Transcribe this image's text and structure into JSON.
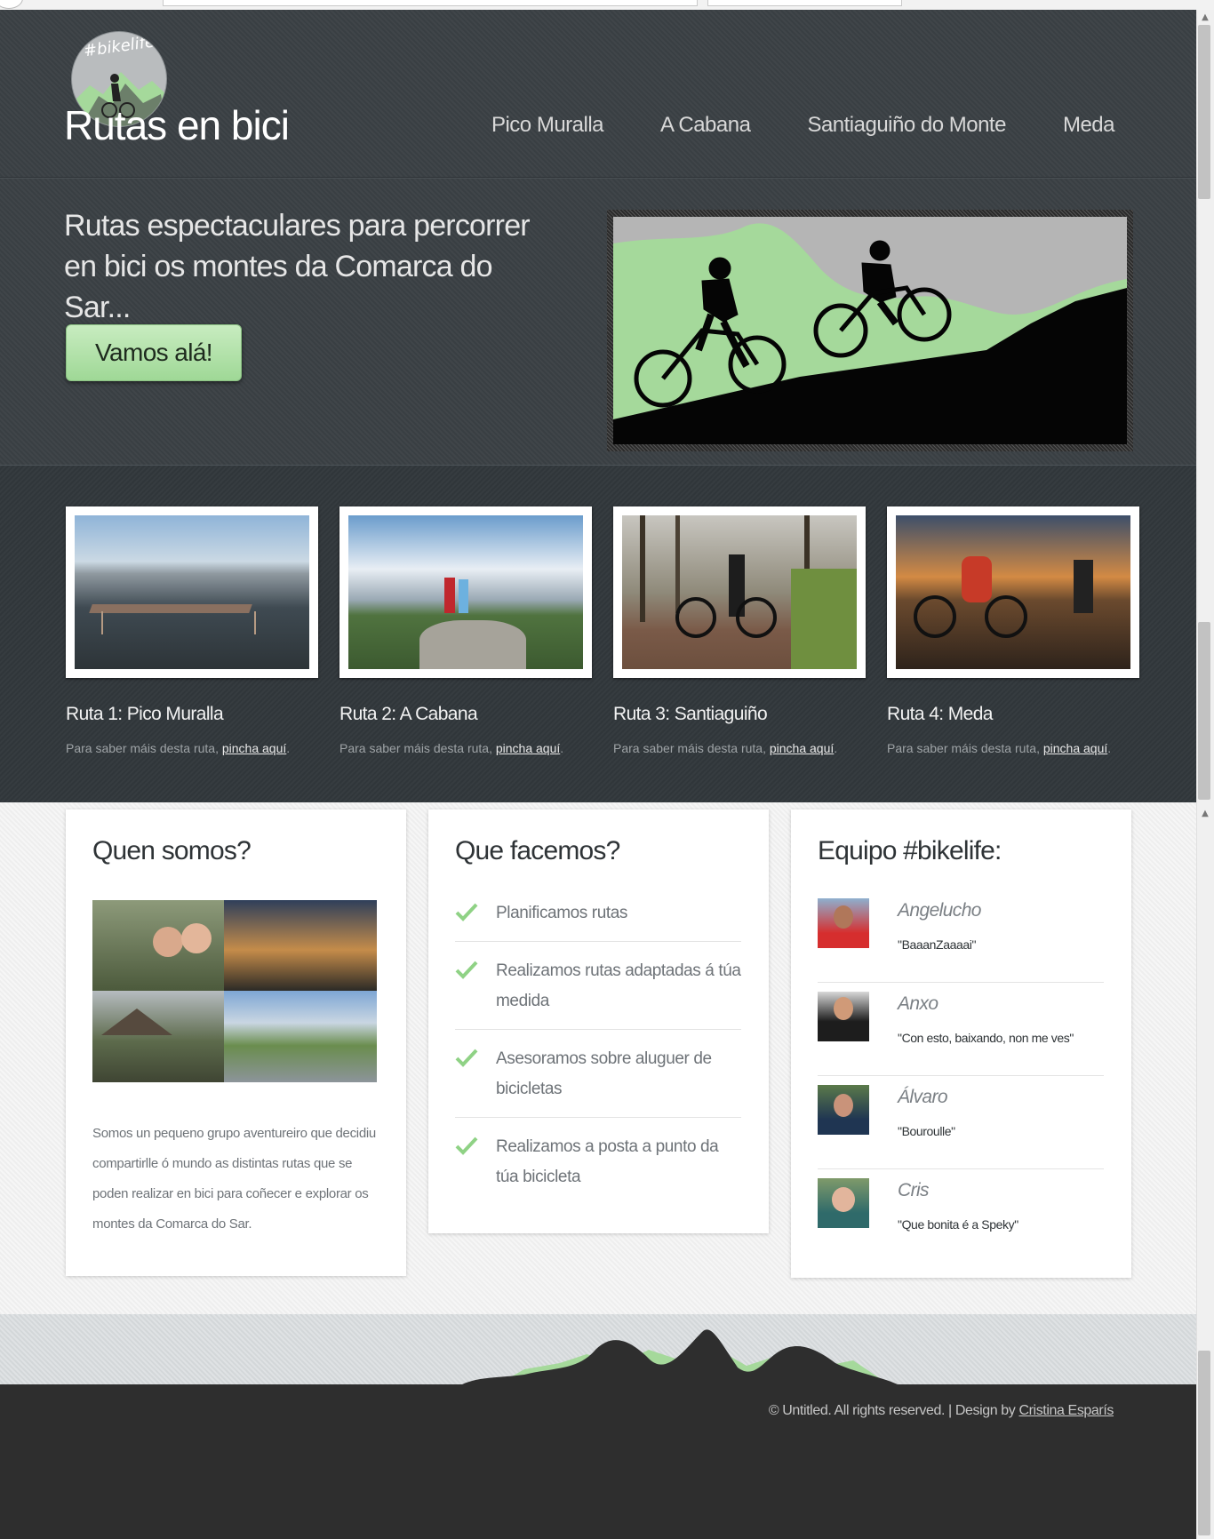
{
  "site": {
    "logo_tag": "#bikelife",
    "title": "Rutas en bici"
  },
  "nav": {
    "items": [
      "Pico Muralla",
      "A Cabana",
      "Santiaguiño do Monte",
      "Meda"
    ]
  },
  "hero": {
    "text": "Rutas espectaculares para percorrer en bici os montes da Comarca do Sar...",
    "button_label": "Vamos alá!"
  },
  "routes": [
    {
      "title": "Ruta 1: Pico Muralla",
      "desc_prefix": "Para saber máis desta ruta, ",
      "link": "pincha aquí",
      "desc_suffix": "."
    },
    {
      "title": "Ruta 2: A Cabana",
      "desc_prefix": "Para saber máis desta ruta, ",
      "link": "pincha aquí",
      "desc_suffix": "."
    },
    {
      "title": "Ruta 3: Santiaguiño",
      "desc_prefix": "Para saber máis desta ruta, ",
      "link": "pincha aquí",
      "desc_suffix": "."
    },
    {
      "title": "Ruta 4: Meda",
      "desc_prefix": "Para saber máis desta ruta, ",
      "link": "pincha aquí",
      "desc_suffix": "."
    }
  ],
  "about": {
    "heading": "Quen somos?",
    "text": "Somos un pequeno grupo aventureiro que decidiu compartirlle ó mundo as distintas rutas que se poden realizar en bici para coñecer e explorar os montes da Comarca do Sar."
  },
  "services": {
    "heading": "Que facemos?",
    "items": [
      "Planificamos rutas",
      "Realizamos rutas adaptadas á túa medida",
      "Asesoramos sobre aluguer de bicicletas",
      "Realizamos a posta a punto da túa bicicleta"
    ]
  },
  "team": {
    "heading": "Equipo #bikelife:",
    "members": [
      {
        "name": "Angelucho",
        "quote": "\"BaaanZaaaai\""
      },
      {
        "name": "Anxo",
        "quote": "\"Con esto, baixando, non me ves\""
      },
      {
        "name": "Álvaro",
        "quote": "\"Bouroulle\""
      },
      {
        "name": "Cris",
        "quote": "\"Que bonita é a Speky\""
      }
    ]
  },
  "footer": {
    "copyright_prefix": "© Untitled. All rights reserved. | Design by ",
    "designer": "Cristina Esparís"
  },
  "colors": {
    "header_bg": "#3b4145",
    "accent_green": "#a5d99b",
    "footer_bg": "#2e2e2e"
  }
}
